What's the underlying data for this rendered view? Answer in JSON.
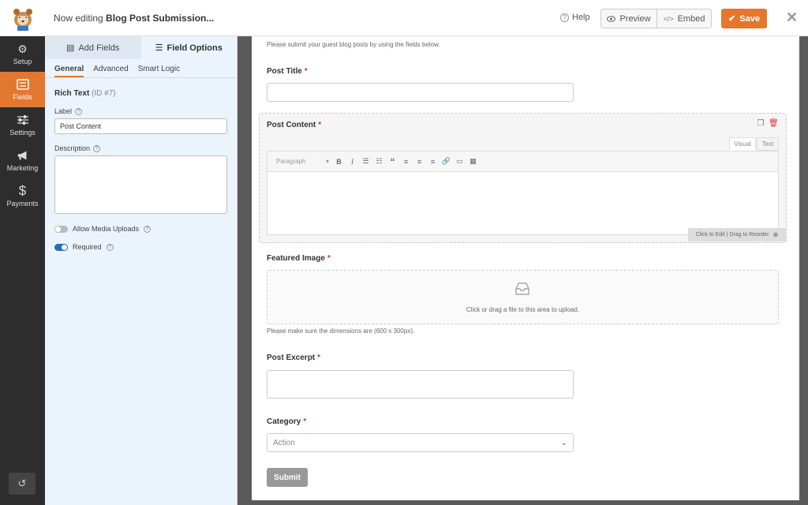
{
  "header": {
    "editing_prefix": "Now editing",
    "form_name": "Blog Post Submission...",
    "help_label": "Help",
    "preview_label": "Preview",
    "embed_label": "Embed",
    "save_label": "Save"
  },
  "nav": {
    "items": [
      {
        "label": "Setup",
        "icon": "gear-icon"
      },
      {
        "label": "Fields",
        "icon": "fields-icon",
        "active": true
      },
      {
        "label": "Settings",
        "icon": "sliders-icon"
      },
      {
        "label": "Marketing",
        "icon": "megaphone-icon"
      },
      {
        "label": "Payments",
        "icon": "dollar-icon"
      }
    ]
  },
  "panel": {
    "tabs": {
      "add_fields": "Add Fields",
      "field_options": "Field Options"
    },
    "subtabs": {
      "general": "General",
      "advanced": "Advanced",
      "smart_logic": "Smart Logic"
    },
    "field_type": "Rich Text",
    "field_id": "(ID #7)",
    "label_caption": "Label",
    "label_value": "Post Content",
    "description_caption": "Description",
    "allow_media": "Allow Media Uploads",
    "required": "Required"
  },
  "form": {
    "intro": "Please submit your guest blog posts by using the fields below.",
    "post_title": "Post Title",
    "post_content": "Post Content",
    "editor": {
      "visual": "Visual",
      "text": "Text",
      "format": "Paragraph"
    },
    "drag_hint": "Click to Edit | Drag to Reorder",
    "featured_image": "Featured Image",
    "upload_text": "Click or drag a file to this area to upload.",
    "dimensions_hint": "Please make sure the dimensions are (600 x 300px).",
    "post_excerpt": "Post Excerpt",
    "category": "Category",
    "category_value": "Action",
    "submit": "Submit",
    "required_mark": "*"
  },
  "colors": {
    "accent": "#e27730",
    "nav_bg": "#2d2d2d",
    "panel_bg": "#ebf3fc",
    "toggle_on": "#1f6fbe"
  }
}
